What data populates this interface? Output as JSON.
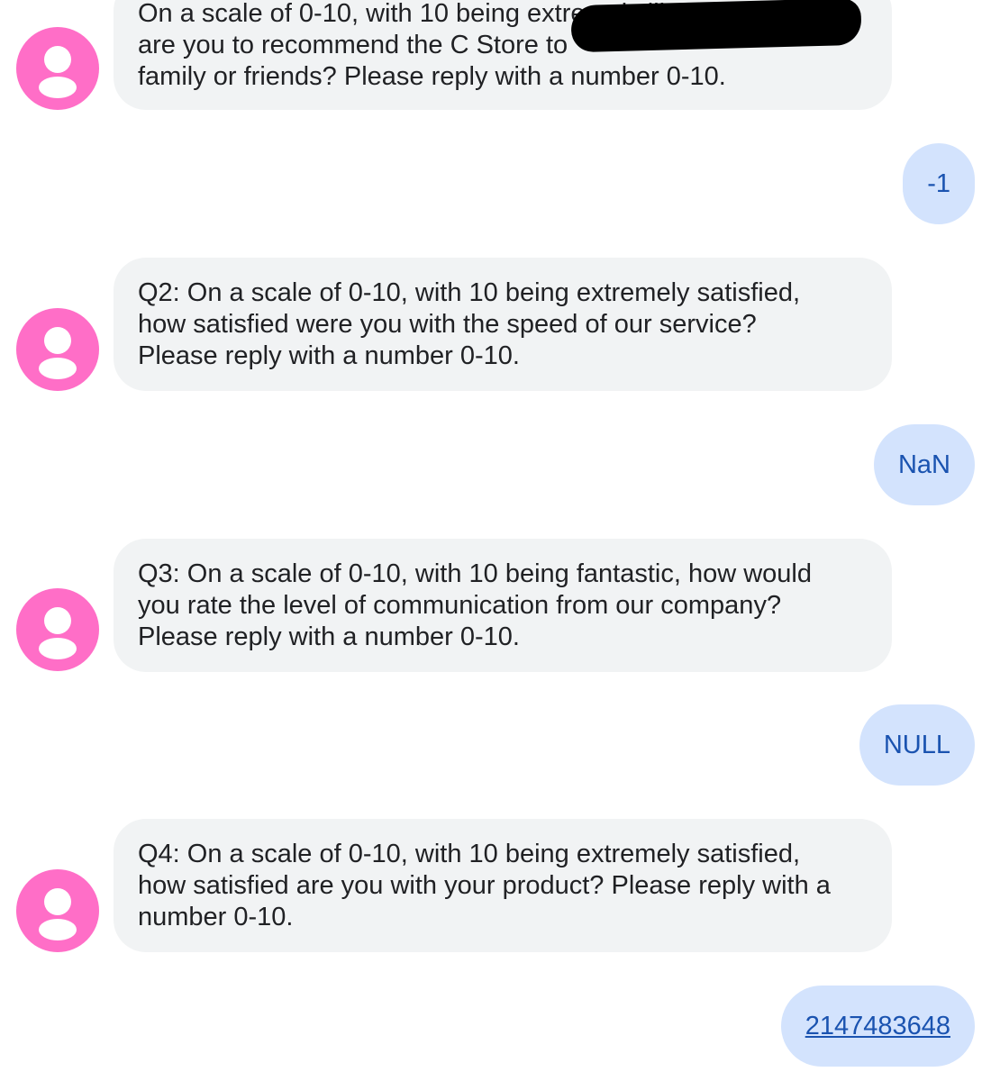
{
  "conversation": {
    "messages": [
      {
        "direction": "incoming",
        "lines": [
          "On a scale of 0-10, with 10 being extremely likely, how likely",
          "are you to recommend the C                              Store to",
          "family or friends? Please reply with a number 0-10."
        ]
      },
      {
        "direction": "outgoing",
        "text": "-1"
      },
      {
        "direction": "incoming",
        "lines": [
          "Q2: On a scale of 0-10, with 10 being extremely satisfied,",
          "how satisfied were you with the speed of our service?",
          "Please reply with a number 0-10."
        ]
      },
      {
        "direction": "outgoing",
        "text": "NaN"
      },
      {
        "direction": "incoming",
        "lines": [
          "Q3: On a scale of 0-10, with 10 being fantastic, how would",
          "you rate the level of communication from our company?",
          "Please reply with a number 0-10."
        ]
      },
      {
        "direction": "outgoing",
        "text": "NULL"
      },
      {
        "direction": "incoming",
        "lines": [
          "Q4: On a scale of 0-10, with 10 being extremely satisfied,",
          "how satisfied are you with your product? Please reply with a",
          "number 0-10."
        ]
      },
      {
        "direction": "outgoing",
        "text": "2147483648",
        "is_link": true
      }
    ]
  },
  "colors": {
    "avatar": "#ff6ec7",
    "incoming_bubble": "#f1f3f4",
    "outgoing_bubble": "#d3e3fd",
    "outgoing_text": "#1a53b0"
  },
  "icons": {
    "avatar": "person-icon"
  }
}
